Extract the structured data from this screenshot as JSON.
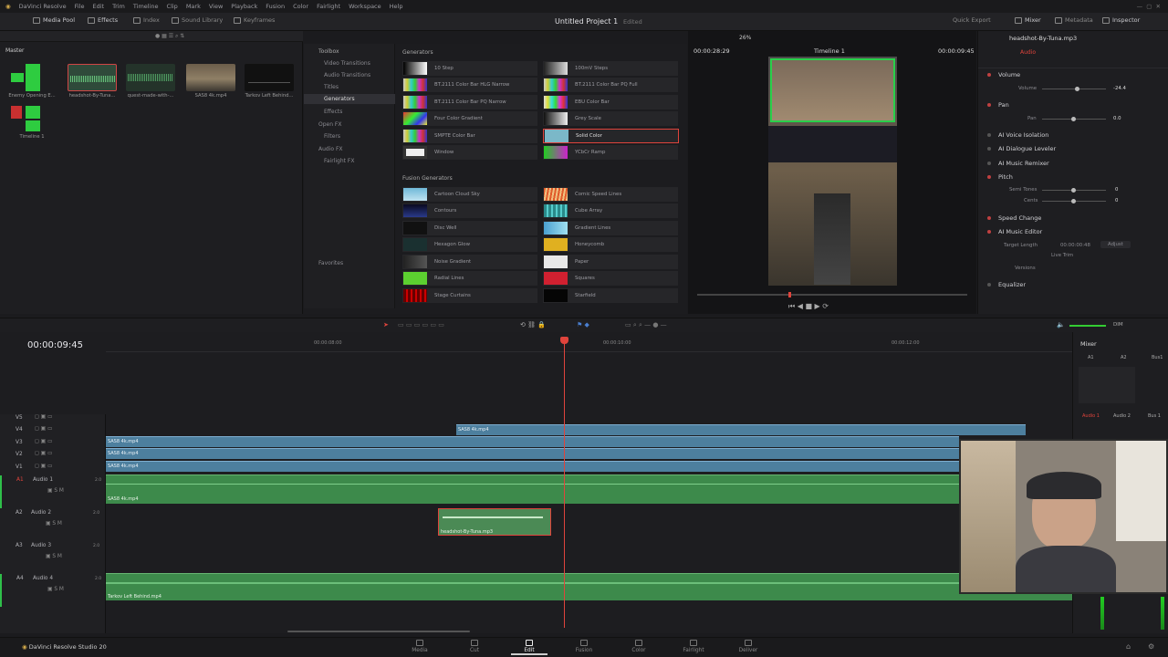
{
  "menu": [
    "DaVinci Resolve",
    "File",
    "Edit",
    "Trim",
    "Timeline",
    "Clip",
    "Mark",
    "View",
    "Playback",
    "Fusion",
    "Color",
    "Fairlight",
    "Workspace",
    "Help"
  ],
  "topbar": {
    "media_pool": "Media Pool",
    "effects": "Effects",
    "index": "Index",
    "sound_library": "Sound Library",
    "keyframes": "Keyframes",
    "project_title": "Untitled Project 1",
    "edited": "Edited",
    "quick_export": "Quick Export",
    "mixer": "Mixer",
    "metadata": "Metadata",
    "inspector": "Inspector"
  },
  "media_pool": {
    "bin": "Master",
    "clips": [
      {
        "name": "Enemy Opening E..."
      },
      {
        "name": "headshot-By-Tuna..."
      },
      {
        "name": "quest-made-with-..."
      },
      {
        "name": "SAS8 4k.mp4"
      },
      {
        "name": "Tarkov Left Behind..."
      },
      {
        "name": "Timeline 1"
      }
    ]
  },
  "effects": {
    "tree": [
      "Toolbox",
      "Video Transitions",
      "Audio Transitions",
      "Titles",
      "Generators",
      "Effects",
      "Open FX",
      "Filters",
      "Audio FX",
      "Fairlight FX"
    ],
    "favorites": "Favorites",
    "generators_header": "Generators",
    "fusion_header": "Fusion Generators",
    "generators": [
      "10 Step",
      "100mV Steps",
      "BT.2111 Color Bar HLG Narrow",
      "BT.2111 Color Bar PQ Full",
      "BT.2111 Color Bar PQ Narrow",
      "EBU Color Bar",
      "Four Color Gradient",
      "Grey Scale",
      "SMPTE Color Bar",
      "Solid Color",
      "Window",
      "YCbCr Ramp"
    ],
    "fusion": [
      "Cartoon Cloud Sky",
      "Comic Speed Lines",
      "Contours",
      "Cube Array",
      "Disc Well",
      "Gradient Lines",
      "Hexagon Glow",
      "Honeycomb",
      "Noise Gradient",
      "Paper",
      "Radial Lines",
      "Squares",
      "Stage Curtains",
      "Starfield"
    ]
  },
  "viewer": {
    "source_tc": "00:00:28:29",
    "zoom": "26%",
    "timeline_name": "Timeline 1",
    "record_tc": "00:00:09:45"
  },
  "inspector": {
    "clip_name": "headshot-By-Tuna.mp3",
    "tab_audio": "Audio",
    "volume_header": "Volume",
    "volume_label": "Volume",
    "volume_value": "-24.4",
    "pan_header": "Pan",
    "pan_label": "Pan",
    "pan_value": "0.0",
    "voice_isolation": "AI Voice Isolation",
    "dialogue_leveler": "AI Dialogue Leveler",
    "music_remixer": "AI Music Remixer",
    "pitch": "Pitch",
    "semitones_label": "Semi Tones",
    "semitones_value": "0",
    "cents_label": "Cents",
    "cents_value": "0",
    "speed_change": "Speed Change",
    "music_editor": "AI Music Editor",
    "target_length_label": "Target Length",
    "target_length_value": "00:00:00:48",
    "adjust": "Adjust",
    "live_trim": "Live Trim",
    "versions": "Versions",
    "equalizer": "Equalizer"
  },
  "timeline": {
    "timecode": "00:00:09:45",
    "ruler": [
      "00:00:08:00",
      "00:00:10:00",
      "00:00:12:00"
    ],
    "tracks": [
      {
        "id": "V5"
      },
      {
        "id": "V4"
      },
      {
        "id": "V3"
      },
      {
        "id": "V2"
      },
      {
        "id": "V1"
      },
      {
        "id": "A1",
        "name": "Audio 1",
        "ch": "2.0"
      },
      {
        "id": "A2",
        "name": "Audio 2",
        "ch": "2.0"
      },
      {
        "id": "A3",
        "name": "Audio 3",
        "ch": "2.0"
      },
      {
        "id": "A4",
        "name": "Audio 4",
        "ch": "2.0"
      }
    ],
    "clips": {
      "v4": "SAS8 4k.mp4",
      "v3": "SAS8 4k.mp4",
      "v2": "SAS8 4k.mp4",
      "v1": "SAS8 4k.mp4",
      "a1": "SAS8 4k.mp4",
      "a2": "headshot-By-Tuna.mp3",
      "a4": "Tarkov Left Behind.mp4"
    }
  },
  "mixer": {
    "title": "Mixer",
    "channels": [
      "A1",
      "A2",
      "Bus1"
    ],
    "names": [
      "Audio 1",
      "Audio 2",
      "Bus 1"
    ],
    "dim": "DIM"
  },
  "pages": [
    "Media",
    "Cut",
    "Edit",
    "Fusion",
    "Color",
    "Fairlight",
    "Deliver"
  ],
  "app_name": "DaVinci Resolve Studio 20",
  "colors": {
    "video_clip": "#4d7f9e",
    "audio_clip": "#3d8a4b",
    "playhead": "#e0443c",
    "selected": "#e0443c"
  }
}
